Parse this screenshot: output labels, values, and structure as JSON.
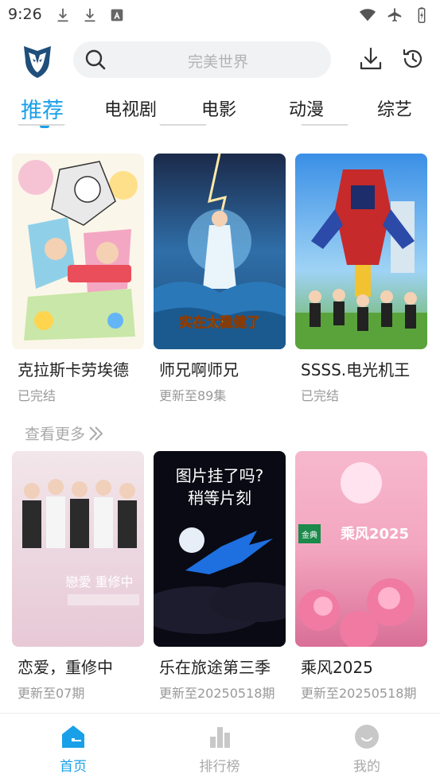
{
  "status_bar": {
    "time": "9:26",
    "left_icons": [
      "download-icon",
      "download-icon",
      "font-a-icon"
    ],
    "right_icons": [
      "wifi-icon",
      "airplane-icon",
      "battery-icon"
    ]
  },
  "header": {
    "logo": "wolf-logo-icon",
    "search": {
      "placeholder": "完美世界"
    },
    "actions": [
      "download-icon",
      "history-icon"
    ]
  },
  "tabs": [
    {
      "label": "推荐",
      "active": true
    },
    {
      "label": "电视剧",
      "active": false
    },
    {
      "label": "电影",
      "active": false
    },
    {
      "label": "动漫",
      "active": false
    },
    {
      "label": "综艺",
      "active": false
    }
  ],
  "sections": [
    {
      "items": [
        {
          "title": "克拉斯卡劳埃德",
          "status": "已完结"
        },
        {
          "title": "师兄啊师兄",
          "status": "更新至89集"
        },
        {
          "title": "SSSS.电光机王",
          "status": "已完结"
        }
      ],
      "more_label": "查看更多"
    },
    {
      "items": [
        {
          "title": "恋爱，重修中",
          "status": "更新至07期"
        },
        {
          "title": "乐在旅途第三季",
          "status": "更新至20250518期"
        },
        {
          "title": "乘风2025",
          "status": "更新至20250518期"
        }
      ]
    }
  ],
  "posters": {
    "poster2_text": "实在太稳健了",
    "poster5_line1": "图片挂了吗?",
    "poster5_line2": "稍等片刻",
    "poster6_badge": "金典",
    "poster6_title": "乘风2025",
    "poster4_text": "戀愛 重修中"
  },
  "bottom_nav": [
    {
      "label": "首页",
      "icon": "home-icon",
      "active": true
    },
    {
      "label": "排行榜",
      "icon": "bar-chart-icon",
      "active": false
    },
    {
      "label": "我的",
      "icon": "smile-icon",
      "active": false
    }
  ],
  "colors": {
    "accent": "#1aa0e8",
    "muted": "#a8a8a8",
    "search_bg": "#f1f2f4"
  }
}
